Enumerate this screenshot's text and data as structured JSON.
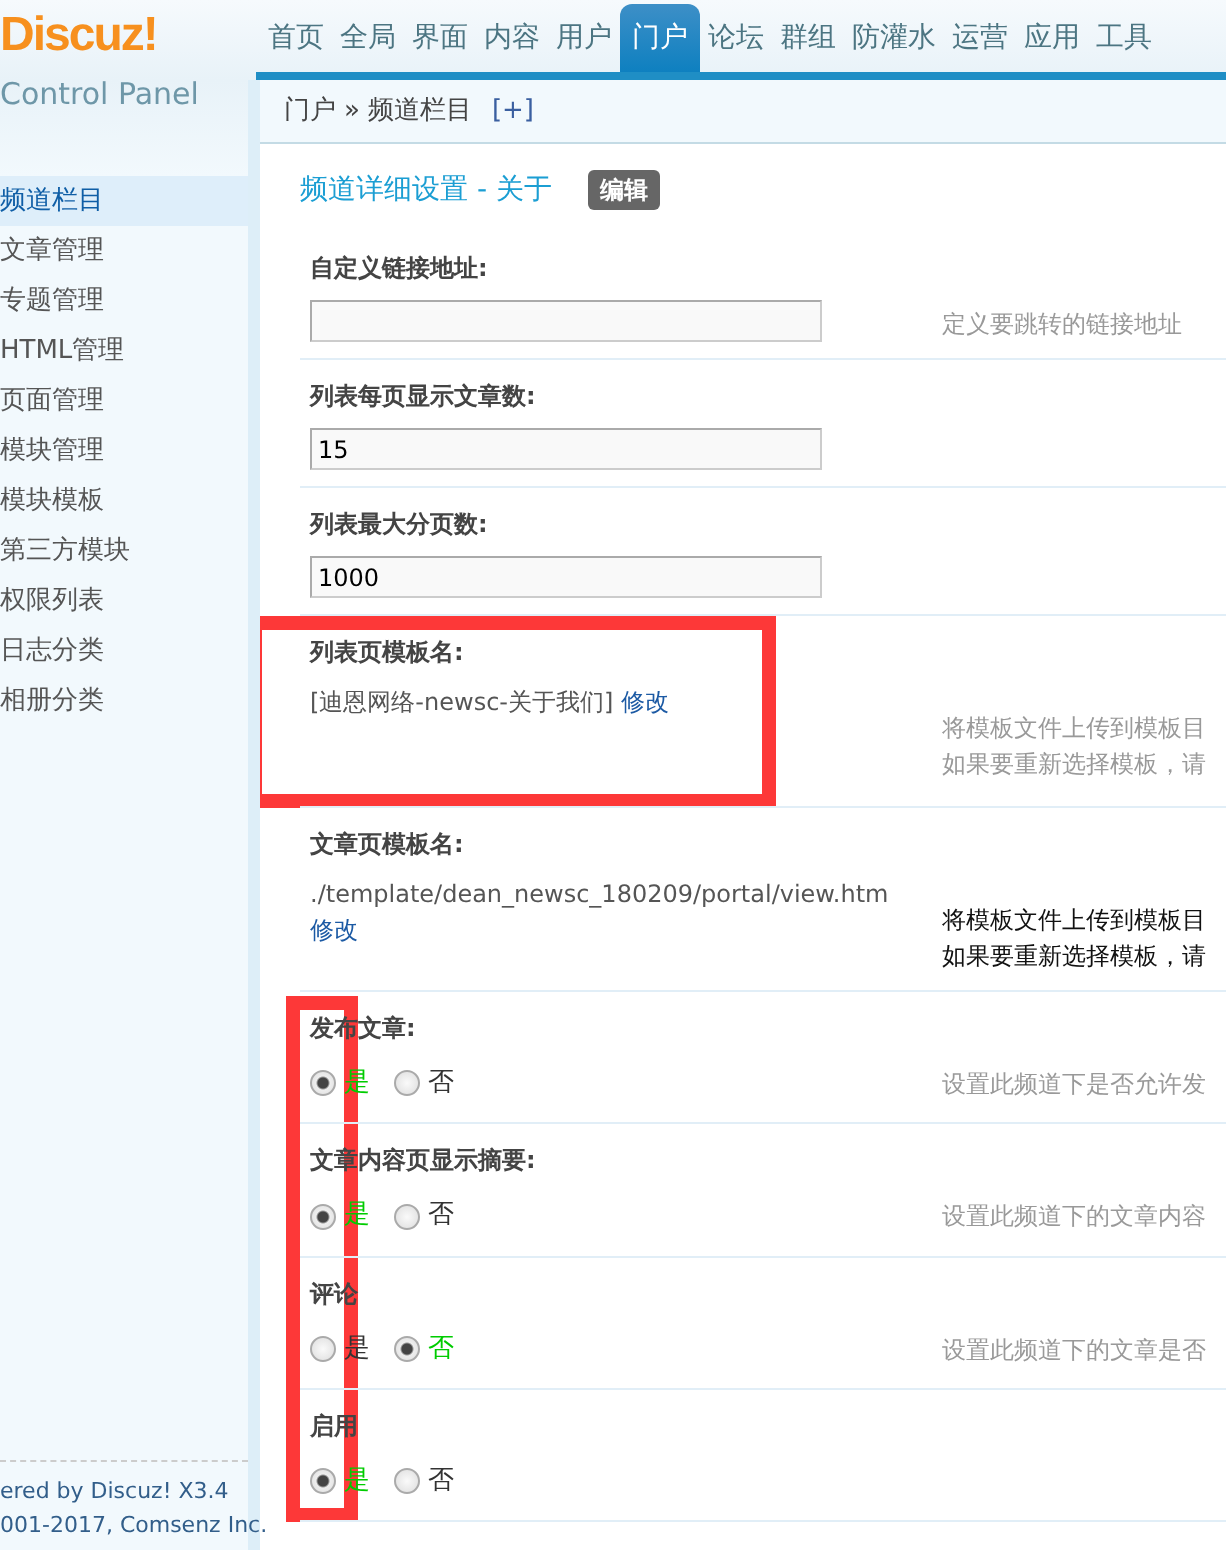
{
  "logo": {
    "brand": "Discuz!",
    "subtitle": "Control Panel"
  },
  "nav_tabs": [
    {
      "label": "首页",
      "selected": false
    },
    {
      "label": "全局",
      "selected": false
    },
    {
      "label": "界面",
      "selected": false
    },
    {
      "label": "内容",
      "selected": false
    },
    {
      "label": "用户",
      "selected": false
    },
    {
      "label": "门户",
      "selected": true
    },
    {
      "label": "论坛",
      "selected": false
    },
    {
      "label": "群组",
      "selected": false
    },
    {
      "label": "防灌水",
      "selected": false
    },
    {
      "label": "运营",
      "selected": false
    },
    {
      "label": "应用",
      "selected": false
    },
    {
      "label": "工具",
      "selected": false
    }
  ],
  "breadcrumb": {
    "items": [
      "门户",
      "频道栏目"
    ],
    "separator": "»",
    "add": "[+]"
  },
  "sidebar": {
    "items": [
      {
        "label": "频道栏目",
        "selected": true
      },
      {
        "label": "文章管理",
        "selected": false
      },
      {
        "label": "专题管理",
        "selected": false
      },
      {
        "label": "HTML管理",
        "selected": false
      },
      {
        "label": "页面管理",
        "selected": false
      },
      {
        "label": "模块管理",
        "selected": false
      },
      {
        "label": "模块模板",
        "selected": false
      },
      {
        "label": "第三方模块",
        "selected": false
      },
      {
        "label": "权限列表",
        "selected": false
      },
      {
        "label": "日志分类",
        "selected": false
      },
      {
        "label": "相册分类",
        "selected": false
      }
    ]
  },
  "footer": {
    "lines": [
      "ered by Discuz! X3.4",
      "001-2017, Comsenz Inc."
    ]
  },
  "form": {
    "title": "频道详细设置 - 关于",
    "edit_badge": "编辑",
    "rows": [
      {
        "kind": "text",
        "label": "自定义链接地址:",
        "value": "",
        "description": [
          "定义要跳转的链接地址"
        ]
      },
      {
        "kind": "text",
        "label": "列表每页显示文章数:",
        "value": "15"
      },
      {
        "kind": "text",
        "label": "列表最大分页数:",
        "value": "1000"
      },
      {
        "kind": "template",
        "label": "列表页模板名:",
        "value": "[迪恩网络-newsc-关于我们]",
        "link": "修改",
        "description": [
          "将模板文件上传到模板目",
          "如果要重新选择模板，请"
        ],
        "description_emphasis": false,
        "highlighted": true
      },
      {
        "kind": "template",
        "label": "文章页模板名:",
        "value": "./template/dean_newsc_180209/portal/view.htm",
        "link": "修改",
        "description": [
          "将模板文件上传到模板目",
          "如果要重新选择模板，请"
        ],
        "description_emphasis": true
      },
      {
        "kind": "radio",
        "label": "发布文章:",
        "options": [
          {
            "label": "是",
            "selected": true
          },
          {
            "label": "否",
            "selected": false
          }
        ],
        "description": [
          "设置此频道下是否允许发"
        ],
        "radios_highlighted": true
      },
      {
        "kind": "radio",
        "label": "文章内容页显示摘要:",
        "options": [
          {
            "label": "是",
            "selected": true
          },
          {
            "label": "否",
            "selected": false
          }
        ],
        "description": [
          "设置此频道下的文章内容"
        ],
        "radios_highlighted": true
      },
      {
        "kind": "radio",
        "label": "评论",
        "options": [
          {
            "label": "是",
            "selected": false
          },
          {
            "label": "否",
            "selected": true
          }
        ],
        "description": [
          "设置此频道下的文章是否"
        ],
        "radios_highlighted": true
      },
      {
        "kind": "radio",
        "label": "启用",
        "options": [
          {
            "label": "是",
            "selected": true
          },
          {
            "label": "否",
            "selected": false
          }
        ],
        "radios_highlighted": true
      }
    ]
  }
}
